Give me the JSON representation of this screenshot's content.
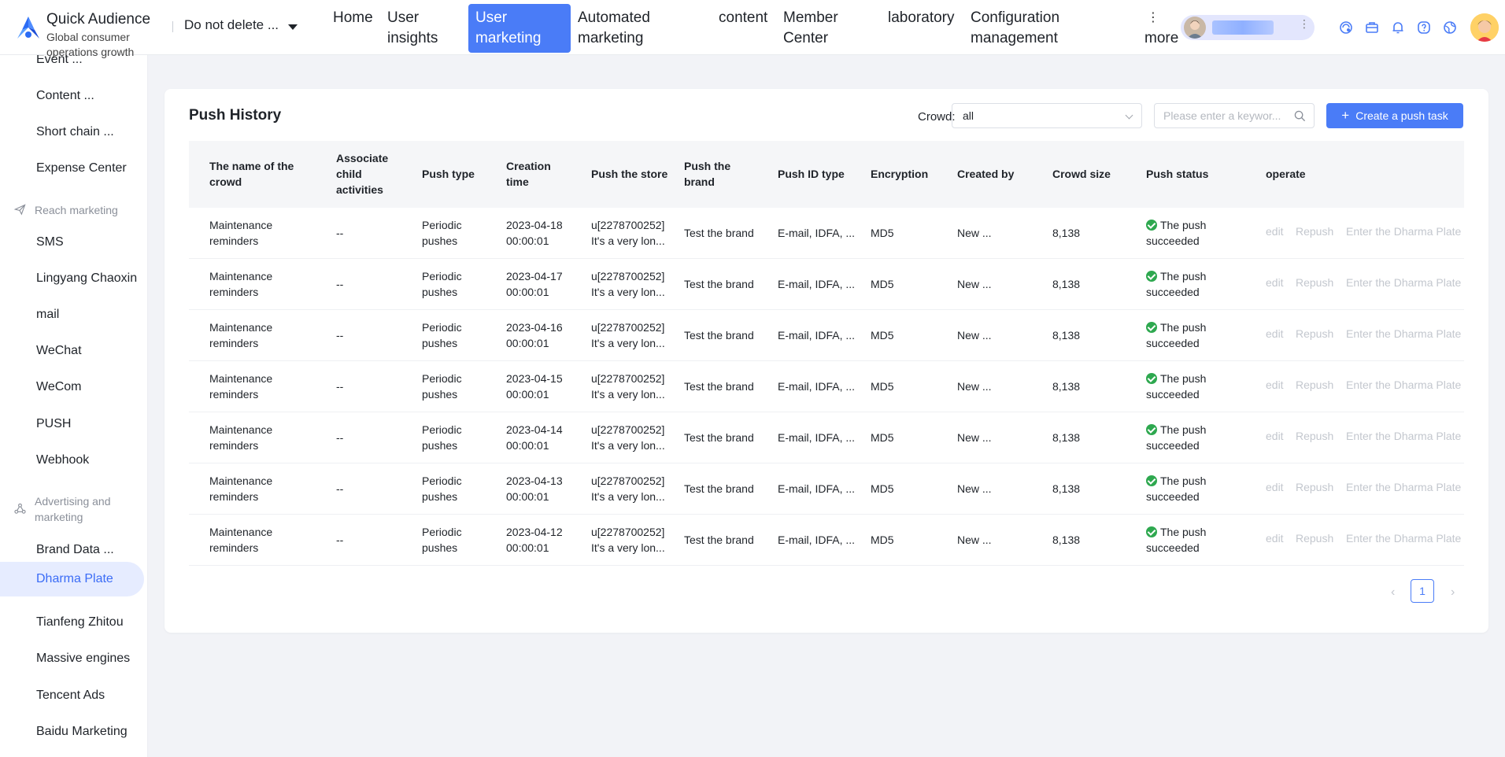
{
  "app": {
    "title": "Quick Audience",
    "subtitle": "Global consumer operations growth",
    "workspace": "Do not delete ..."
  },
  "nav": {
    "items": [
      "Home",
      "User insights",
      "User marketing",
      "Automated marketing",
      "content",
      "Member Center",
      "laboratory",
      "Configuration management",
      "more"
    ],
    "active": "User marketing"
  },
  "header_icons": [
    "sync-icon",
    "briefcase-icon",
    "bell-icon",
    "help-icon",
    "globe-icon"
  ],
  "sidebar": {
    "items_top": [
      "Event ...",
      "Content ...",
      "Short chain ...",
      "Expense Center"
    ],
    "group_reach": "Reach marketing",
    "items_reach": [
      "SMS",
      "Lingyang Chaoxin",
      "mail",
      "WeChat",
      "WeCom",
      "PUSH",
      "Webhook"
    ],
    "group_ads": "Advertising and marketing",
    "items_ads": [
      "Brand Data ...",
      "Dharma Plate",
      "Tianfeng Zhitou",
      "Massive engines",
      "Tencent Ads",
      "Baidu Marketing"
    ],
    "active": "Dharma Plate"
  },
  "page": {
    "title": "Push History",
    "crowd_label": "Crowd:",
    "crowd_value": "all",
    "search_placeholder": "Please enter a keywor...",
    "create_button": "Create a push task",
    "accent": "#4a7cf7",
    "success_color": "#2ea84f"
  },
  "table": {
    "headers": [
      "The name of the crowd",
      "Associate child activities",
      "Push type",
      "Creation time",
      "Push the store",
      "Push the brand",
      "Push ID type",
      "Encryption",
      "Created by",
      "Crowd size",
      "Push status",
      "operate"
    ],
    "rows": [
      {
        "name": "Maintenance reminders",
        "child": "--",
        "type": "Periodic pushes",
        "time": "2023-04-18 00:00:01",
        "store": "u[2278700252] It's a very lon...",
        "brand": "Test the brand",
        "idtype": "E-mail, IDFA, ...",
        "enc": "MD5",
        "creator": "New ...",
        "size": "8,138",
        "status": "The push succeeded"
      },
      {
        "name": "Maintenance reminders",
        "child": "--",
        "type": "Periodic pushes",
        "time": "2023-04-17 00:00:01",
        "store": "u[2278700252] It's a very lon...",
        "brand": "Test the brand",
        "idtype": "E-mail, IDFA, ...",
        "enc": "MD5",
        "creator": "New ...",
        "size": "8,138",
        "status": "The push succeeded"
      },
      {
        "name": "Maintenance reminders",
        "child": "--",
        "type": "Periodic pushes",
        "time": "2023-04-16 00:00:01",
        "store": "u[2278700252] It's a very lon...",
        "brand": "Test the brand",
        "idtype": "E-mail, IDFA, ...",
        "enc": "MD5",
        "creator": "New ...",
        "size": "8,138",
        "status": "The push succeeded"
      },
      {
        "name": "Maintenance reminders",
        "child": "--",
        "type": "Periodic pushes",
        "time": "2023-04-15 00:00:01",
        "store": "u[2278700252] It's a very lon...",
        "brand": "Test the brand",
        "idtype": "E-mail, IDFA, ...",
        "enc": "MD5",
        "creator": "New ...",
        "size": "8,138",
        "status": "The push succeeded"
      },
      {
        "name": "Maintenance reminders",
        "child": "--",
        "type": "Periodic pushes",
        "time": "2023-04-14 00:00:01",
        "store": "u[2278700252] It's a very lon...",
        "brand": "Test the brand",
        "idtype": "E-mail, IDFA, ...",
        "enc": "MD5",
        "creator": "New ...",
        "size": "8,138",
        "status": "The push succeeded"
      },
      {
        "name": "Maintenance reminders",
        "child": "--",
        "type": "Periodic pushes",
        "time": "2023-04-13 00:00:01",
        "store": "u[2278700252] It's a very lon...",
        "brand": "Test the brand",
        "idtype": "E-mail, IDFA, ...",
        "enc": "MD5",
        "creator": "New ...",
        "size": "8,138",
        "status": "The push succeeded"
      },
      {
        "name": "Maintenance reminders",
        "child": "--",
        "type": "Periodic pushes",
        "time": "2023-04-12 00:00:01",
        "store": "u[2278700252] It's a very lon...",
        "brand": "Test the brand",
        "idtype": "E-mail, IDFA, ...",
        "enc": "MD5",
        "creator": "New ...",
        "size": "8,138",
        "status": "The push succeeded"
      }
    ],
    "operations": [
      "edit",
      "Repush",
      "Enter the Dharma Plate"
    ]
  },
  "pagination": {
    "current": "1",
    "prev": "‹",
    "next": "›"
  }
}
